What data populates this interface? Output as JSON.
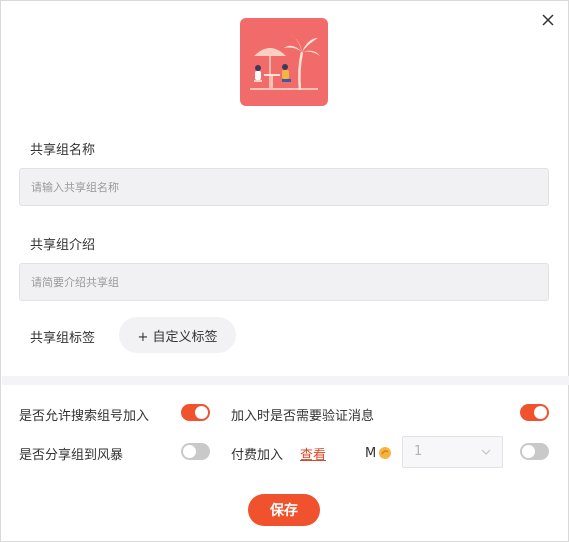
{
  "dialog": {
    "close_icon": "close-icon",
    "cover_icon": "beach-illustration-icon"
  },
  "form": {
    "name_label": "共享组名称",
    "name_placeholder": "请输入共享组名称",
    "intro_label": "共享组介绍",
    "intro_placeholder": "请简要介绍共享组",
    "tag_label": "共享组标签",
    "tag_button": "+ 自定义标签"
  },
  "settings": {
    "allow_search_label": "是否允许搜索组号加入",
    "allow_search_on": true,
    "verify_label": "加入时是否需要验证消息",
    "verify_on": true,
    "share_storm_label": "是否分享组到风暴",
    "share_storm_on": false,
    "paid_join_label": "付费加入",
    "view_link": "查看",
    "currency_label": "M",
    "currency_icon": "coin-icon",
    "price_value": "1",
    "paid_join_on": false
  },
  "footer": {
    "save_label": "保存"
  },
  "colors": {
    "accent": "#f0522e",
    "cover_bg": "#f26b6b",
    "toggle_off": "#c9c9c9"
  }
}
